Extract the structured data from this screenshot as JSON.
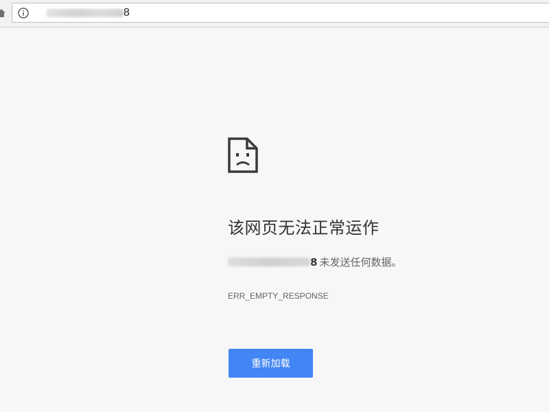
{
  "browser": {
    "address_bar": {
      "url_visible_suffix": "8"
    }
  },
  "error_page": {
    "icon": "sad-page-icon",
    "title": "该网页无法正常运作",
    "description": {
      "host_visible_suffix": "8",
      "message": "未发送任何数据。"
    },
    "error_code": "ERR_EMPTY_RESPONSE",
    "reload_button_label": "重新加载"
  },
  "colors": {
    "button_accent": "#4285f4",
    "page_background": "#f7f7f7",
    "title_text": "#333333",
    "secondary_text": "#646464"
  }
}
